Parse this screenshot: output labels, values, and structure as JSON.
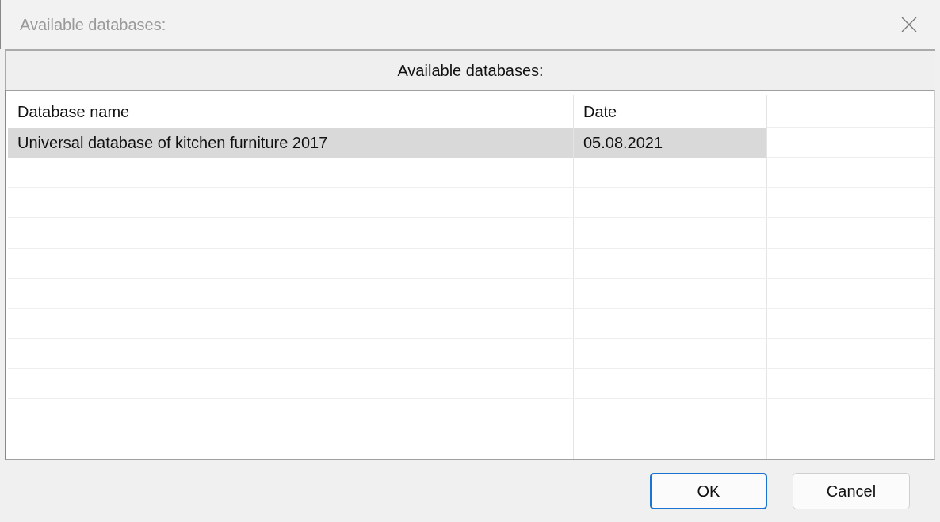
{
  "window": {
    "title": "Available databases:"
  },
  "panel": {
    "heading": "Available databases:"
  },
  "table": {
    "columns": [
      "Database name",
      "Date"
    ],
    "rows": [
      {
        "cells": [
          "Universal database of kitchen furniture 2017",
          "05.08.2021"
        ],
        "selected": true
      }
    ]
  },
  "buttons": [
    {
      "label": "OK",
      "default": true
    },
    {
      "label": "Cancel",
      "default": false
    }
  ]
}
